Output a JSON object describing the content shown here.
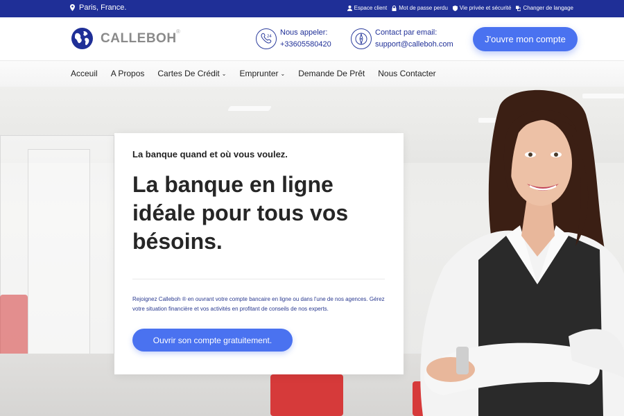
{
  "topbar": {
    "location": "Paris, France.",
    "links": [
      {
        "label": "Espace client",
        "icon": "user-icon"
      },
      {
        "label": "Mot de passe perdu",
        "icon": "lock-icon"
      },
      {
        "label": "Vie privée et sécurité",
        "icon": "shield-icon"
      },
      {
        "label": "Changer de langage",
        "icon": "translate-icon"
      }
    ]
  },
  "header": {
    "brand": "CALLEBOH",
    "registered": "®",
    "phone": {
      "label": "Nous appeler:",
      "value": "+33605580420",
      "icon": "phone-24-icon"
    },
    "email": {
      "label": "Contact par email:",
      "value": "support@calleboh.com",
      "icon": "compass-icon"
    },
    "cta": "J'ouvre mon compte"
  },
  "nav": {
    "items": [
      {
        "label": "Acceuil",
        "dropdown": false
      },
      {
        "label": "A Propos",
        "dropdown": false
      },
      {
        "label": "Cartes De Crédit",
        "dropdown": true
      },
      {
        "label": "Emprunter",
        "dropdown": true
      },
      {
        "label": "Demande De Prêt",
        "dropdown": false
      },
      {
        "label": "Nous Contacter",
        "dropdown": false
      }
    ]
  },
  "hero": {
    "tagline": "La banque quand et où vous voulez.",
    "headline": "La banque en ligne idéale pour tous vos bésoins.",
    "description": "Rejoignez Calleboh ® en ouvrant votre compte bancaire en ligne ou dans l'une de nos agences. Gérez votre situation financière et vos activités en profitant de conseils de nos experts.",
    "cta": "Ouvrir son compte gratuitement."
  },
  "colors": {
    "topbar": "#1f2f97",
    "accent": "#4a72f0",
    "text_blue": "#2a3a90"
  }
}
